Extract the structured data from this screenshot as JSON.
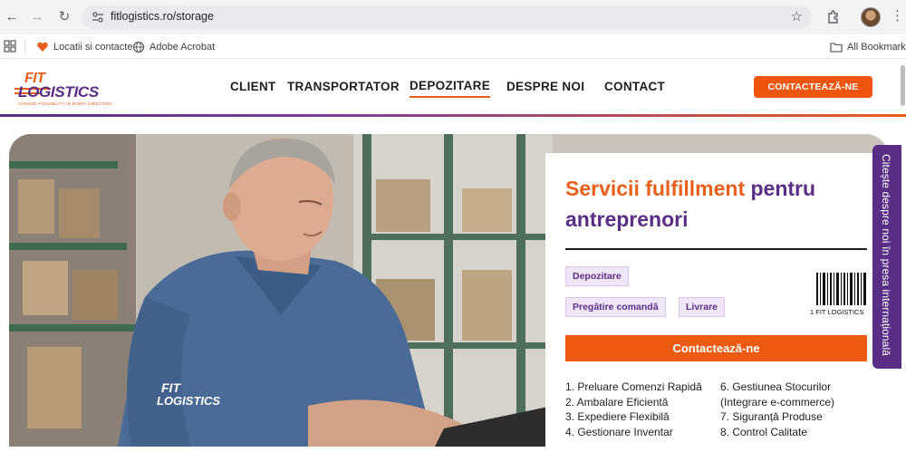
{
  "browser": {
    "url": "fitlogistics.ro/storage",
    "bookmarks": [
      {
        "label": "Locatii si contacte",
        "icon": "heart-bookmark-icon"
      },
      {
        "label": "Adobe Acrobat",
        "icon": "globe-icon"
      }
    ],
    "all_bookmarks_label": "All Bookmarks"
  },
  "site": {
    "logo": {
      "line1": "FIT",
      "line2": "LOGISTICS",
      "tagline": "CHOOSE POSSIBILITY IN EVERY DIRECTION"
    },
    "menu": [
      {
        "label": "CLIENT"
      },
      {
        "label": "TRANSPORTATOR"
      },
      {
        "label": "DEPOZITARE",
        "active": true
      },
      {
        "label": "DESPRE NOI"
      },
      {
        "label": "CONTACT"
      }
    ],
    "header_cta": "CONTACTEAZĂ-NE",
    "colors": {
      "orange": "#EE5A0F",
      "purple": "#5A2D86"
    }
  },
  "hero": {
    "title_accent": "Servicii fulfillment",
    "title_rest": " pentru antreprenori",
    "tags": [
      "Depozitare",
      "Pregătire comandă",
      "Livrare"
    ],
    "barcode_text": "1 FIT  LOGISTICS",
    "cta": "Contactează-ne",
    "shirt_logo_line1": "FIT",
    "shirt_logo_line2": "LOGISTICS",
    "features_left": [
      "1. Preluare Comenzi Rapidă",
      "2. Ambalare Eficientă",
      "3. Expediere Flexibilă",
      "4. Gestionare Inventar"
    ],
    "features_right": [
      "6. Gestiunea Stocurilor",
      "(Integrare e-commerce)",
      "7. Siguranță Produse",
      "8. Control Calitate"
    ]
  },
  "side_tab": "Citește despre noi în presa internațională"
}
